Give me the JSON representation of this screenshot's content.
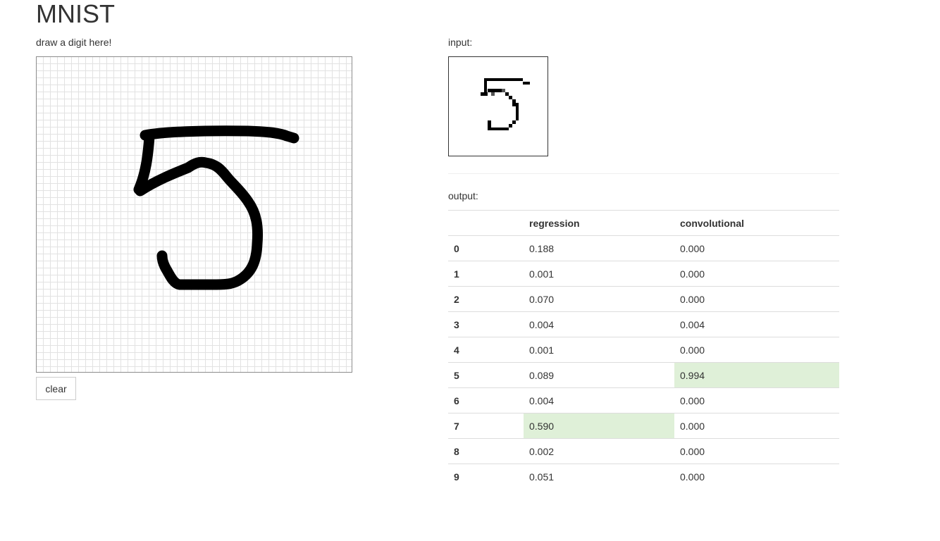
{
  "page": {
    "title": "MNIST"
  },
  "canvas": {
    "label": "draw a digit here!",
    "clear_label": "clear"
  },
  "input": {
    "label": "input:"
  },
  "output": {
    "label": "output:",
    "headers": [
      "",
      "regression",
      "convolutional"
    ],
    "rows": [
      {
        "digit": "0",
        "regression": "0.188",
        "convolutional": "0.000"
      },
      {
        "digit": "1",
        "regression": "0.001",
        "convolutional": "0.000"
      },
      {
        "digit": "2",
        "regression": "0.070",
        "convolutional": "0.000"
      },
      {
        "digit": "3",
        "regression": "0.004",
        "convolutional": "0.004"
      },
      {
        "digit": "4",
        "regression": "0.001",
        "convolutional": "0.000"
      },
      {
        "digit": "5",
        "regression": "0.089",
        "convolutional": "0.994"
      },
      {
        "digit": "6",
        "regression": "0.004",
        "convolutional": "0.000"
      },
      {
        "digit": "7",
        "regression": "0.590",
        "convolutional": "0.000"
      },
      {
        "digit": "8",
        "regression": "0.002",
        "convolutional": "0.000"
      },
      {
        "digit": "9",
        "regression": "0.051",
        "convolutional": "0.000"
      }
    ],
    "highlight_color": "#dff0d8"
  }
}
